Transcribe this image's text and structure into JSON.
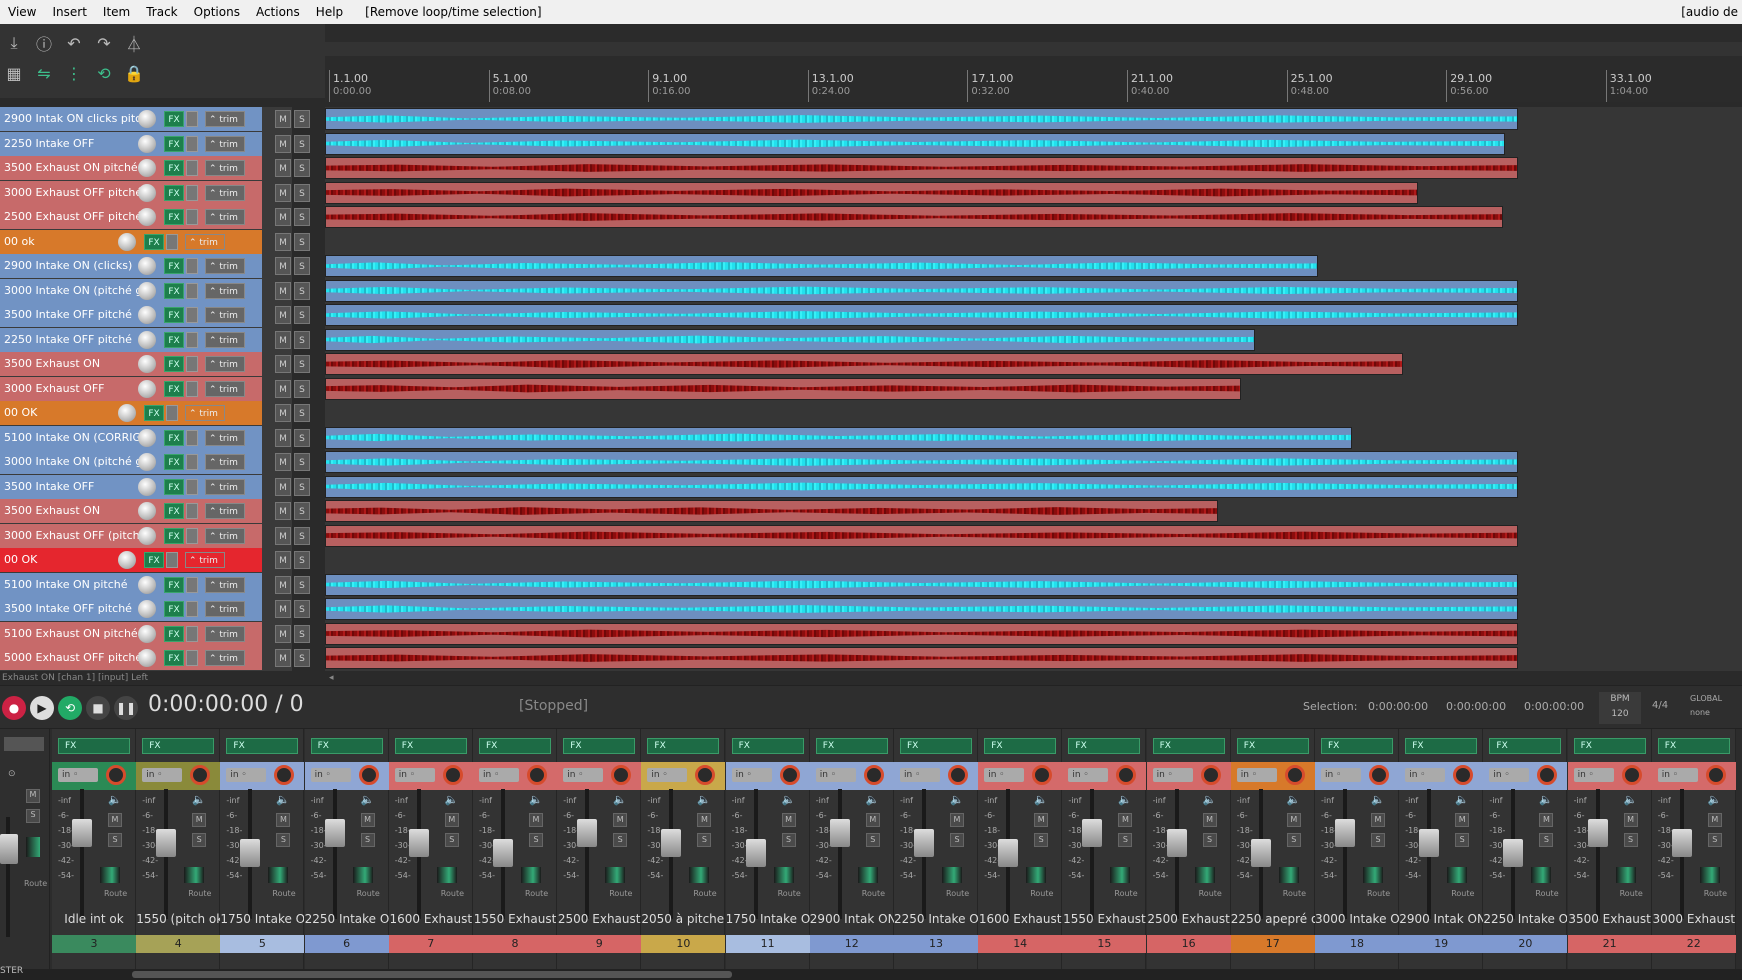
{
  "menu": {
    "items": [
      "View",
      "Insert",
      "Item",
      "Track",
      "Options",
      "Actions",
      "Help"
    ],
    "status": "[Remove loop/time selection]",
    "right": "[audio de"
  },
  "toolbar": {
    "row1_icons": [
      "save-icon",
      "info-icon",
      "undo-icon",
      "redo-icon",
      "metronome-icon"
    ],
    "row2_icons": [
      "grid-icon",
      "ripple-icon",
      "snap-icon",
      "loop-icon",
      "lock-icon"
    ]
  },
  "ruler": {
    "ticks": [
      {
        "bar": "1.1.00",
        "time": "0:00.00"
      },
      {
        "bar": "5.1.00",
        "time": "0:08.00"
      },
      {
        "bar": "9.1.00",
        "time": "0:16.00"
      },
      {
        "bar": "13.1.00",
        "time": "0:24.00"
      },
      {
        "bar": "17.1.00",
        "time": "0:32.00"
      },
      {
        "bar": "21.1.00",
        "time": "0:40.00"
      },
      {
        "bar": "25.1.00",
        "time": "0:48.00"
      },
      {
        "bar": "29.1.00",
        "time": "0:56.00"
      },
      {
        "bar": "33.1.00",
        "time": "1:04.00"
      }
    ]
  },
  "tracks": [
    {
      "name": "2900 Intak ON clicks pitc",
      "color": "#7193c4",
      "clip_end": 1193,
      "wave": "cyan",
      "clip_color": "#6d8fc0"
    },
    {
      "name": "2250 Intake OFF",
      "color": "#7193c4",
      "clip_end": 1180,
      "wave": "cyan",
      "clip_color": "#6d8fc0"
    },
    {
      "name": "3500 Exhaust ON pitché",
      "color": "#c76a6a",
      "clip_end": 1193,
      "wave": "red",
      "clip_color": "#b86060"
    },
    {
      "name": "3000 Exhaust OFF pitché",
      "color": "#c76a6a",
      "clip_end": 1093,
      "wave": "red",
      "clip_color": "#b86060"
    },
    {
      "name": "2500 Exhaust OFF pitché",
      "color": "#c76a6a",
      "clip_end": 1178,
      "wave": "red",
      "clip_color": "#b86060"
    },
    {
      "name": "00 ok",
      "color": "#d7792a",
      "clip_end": 0,
      "wave": "none",
      "clip_color": "#444",
      "folder": true
    },
    {
      "name": "2900 Intake ON (clicks)",
      "color": "#7193c4",
      "clip_end": 993,
      "wave": "cyan",
      "clip_color": "#6d8fc0"
    },
    {
      "name": "3000 Intake ON (pitché g",
      "color": "#7193c4",
      "clip_end": 1193,
      "wave": "cyan",
      "clip_color": "#6d8fc0"
    },
    {
      "name": "3500 Intake OFF pitché",
      "color": "#7193c4",
      "clip_end": 1193,
      "wave": "cyan",
      "clip_color": "#6d8fc0"
    },
    {
      "name": "2250 Intake OFF pitché",
      "color": "#7193c4",
      "clip_end": 930,
      "wave": "cyan",
      "clip_color": "#6d8fc0"
    },
    {
      "name": "3500 Exhaust ON",
      "color": "#c76a6a",
      "clip_end": 1078,
      "wave": "red",
      "clip_color": "#b86060"
    },
    {
      "name": "3000 Exhaust OFF",
      "color": "#c76a6a",
      "clip_end": 916,
      "wave": "red",
      "clip_color": "#b86060"
    },
    {
      "name": "00 OK",
      "color": "#d7792a",
      "clip_end": 0,
      "wave": "none",
      "clip_color": "#444",
      "folder": true
    },
    {
      "name": "5100 Intake ON (CORRIG",
      "color": "#7193c4",
      "clip_end": 1027,
      "wave": "cyan",
      "clip_color": "#6d8fc0"
    },
    {
      "name": "3000 Intake ON (pitché g",
      "color": "#7193c4",
      "clip_end": 1193,
      "wave": "cyan",
      "clip_color": "#6d8fc0"
    },
    {
      "name": "3500 Intake OFF",
      "color": "#7193c4",
      "clip_end": 1193,
      "wave": "cyan",
      "clip_color": "#6d8fc0"
    },
    {
      "name": "3500 Exhaust ON",
      "color": "#c76a6a",
      "clip_end": 893,
      "wave": "red",
      "clip_color": "#b86060"
    },
    {
      "name": "3000 Exhaust OFF (pitch",
      "color": "#c76a6a",
      "clip_end": 1193,
      "wave": "red",
      "clip_color": "#b86060"
    },
    {
      "name": "00 OK",
      "color": "#e5262e",
      "clip_end": 0,
      "wave": "none",
      "clip_color": "#444",
      "folder": true
    },
    {
      "name": "5100 Intake ON pitché",
      "color": "#7193c4",
      "clip_end": 1193,
      "wave": "cyan",
      "clip_color": "#6d8fc0"
    },
    {
      "name": "3500 Intake OFF pitché",
      "color": "#7193c4",
      "clip_end": 1193,
      "wave": "cyan",
      "clip_color": "#6d8fc0"
    },
    {
      "name": "5100 Exhaust ON pitché",
      "color": "#c76a6a",
      "clip_end": 1193,
      "wave": "red",
      "clip_color": "#b86060"
    },
    {
      "name": "5000 Exhaust OFF pitché",
      "color": "#c76a6a",
      "clip_end": 1193,
      "wave": "red",
      "clip_color": "#b86060"
    }
  ],
  "track_buttons": {
    "fx": "FX",
    "trim": "trim",
    "mute": "M",
    "solo": "S"
  },
  "status_line": "Exhaust ON [chan 1] [input] Left",
  "transport": {
    "time": "0:00:00:00 / 0",
    "state": "[Stopped]",
    "selection_label": "Selection:",
    "selection_values": [
      "0:00:00:00",
      "0:00:00:00",
      "0:00:00:00"
    ],
    "bpm_label": "BPM",
    "bpm_value": "120",
    "time_sig": "4/4",
    "global_label": "GLOBAL",
    "global_value": "none"
  },
  "mixer": {
    "master_label": "STER",
    "db_scale": [
      "-inf",
      "-6-",
      "-18-",
      "-30-",
      "-42-",
      "-54-"
    ],
    "in_label": "in",
    "route_label": "Route",
    "strips": [
      {
        "name": "Idle int ok",
        "num": "3",
        "head": "#2b8a55",
        "numcolor": "#3a8a5e"
      },
      {
        "name": "1550 (pitch ok",
        "num": "4",
        "head": "#8a8a3a",
        "numcolor": "#a6a257"
      },
      {
        "name": "1750 Intake O",
        "num": "5",
        "head": "#8fa6d4",
        "numcolor": "#a8bde0"
      },
      {
        "name": "2250 Intake O",
        "num": "6",
        "head": "#8fa6d4",
        "numcolor": "#7f99d0"
      },
      {
        "name": "1600 Exhaust",
        "num": "7",
        "head": "#d46a6a",
        "numcolor": "#d66565"
      },
      {
        "name": "1550 Exhaust",
        "num": "8",
        "head": "#d46a6a",
        "numcolor": "#d66565"
      },
      {
        "name": "2500 Exhaust",
        "num": "9",
        "head": "#d46a6a",
        "numcolor": "#d66565"
      },
      {
        "name": "2050 à pitcher",
        "num": "10",
        "head": "#c9a84a",
        "numcolor": "#c9a84a"
      },
      {
        "name": "1750 Intake O",
        "num": "11",
        "head": "#8fa6d4",
        "numcolor": "#a8bde0"
      },
      {
        "name": "2900 Intak ON",
        "num": "12",
        "head": "#8fa6d4",
        "numcolor": "#7f99d0"
      },
      {
        "name": "2250 Intake O",
        "num": "13",
        "head": "#8fa6d4",
        "numcolor": "#7f99d0"
      },
      {
        "name": "1600 Exhaust",
        "num": "14",
        "head": "#d46a6a",
        "numcolor": "#d66565"
      },
      {
        "name": "1550 Exhaust",
        "num": "15",
        "head": "#d46a6a",
        "numcolor": "#d66565"
      },
      {
        "name": "2500 Exhaust",
        "num": "16",
        "head": "#d46a6a",
        "numcolor": "#d66565"
      },
      {
        "name": "2250 apepré o",
        "num": "17",
        "head": "#d7792a",
        "numcolor": "#d7792a"
      },
      {
        "name": "3000 Intake O",
        "num": "18",
        "head": "#8fa6d4",
        "numcolor": "#7f99d0"
      },
      {
        "name": "2900 Intak ON",
        "num": "19",
        "head": "#8fa6d4",
        "numcolor": "#7f99d0"
      },
      {
        "name": "2250 Intake O",
        "num": "20",
        "head": "#8fa6d4",
        "numcolor": "#7f99d0"
      },
      {
        "name": "3500 Exhaust",
        "num": "21",
        "head": "#d46a6a",
        "numcolor": "#d66565"
      },
      {
        "name": "3000 Exhaust",
        "num": "22",
        "head": "#d46a6a",
        "numcolor": "#d66565"
      }
    ]
  }
}
